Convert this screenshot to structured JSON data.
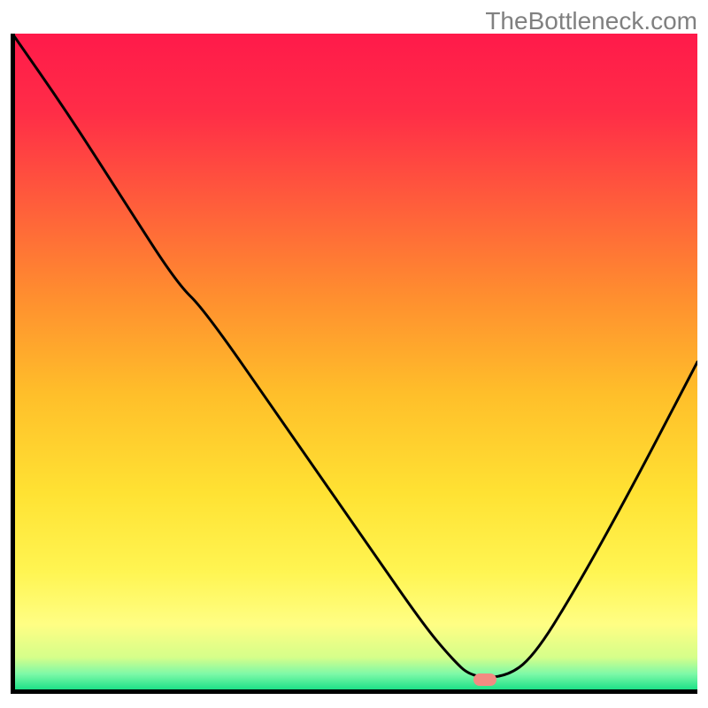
{
  "watermark": "TheBottleneck.com",
  "gradient": {
    "stops": [
      {
        "offset": 0.0,
        "color": "#ff1a4a"
      },
      {
        "offset": 0.12,
        "color": "#ff2d47"
      },
      {
        "offset": 0.25,
        "color": "#ff5a3c"
      },
      {
        "offset": 0.4,
        "color": "#ff8e2f"
      },
      {
        "offset": 0.55,
        "color": "#ffbf2a"
      },
      {
        "offset": 0.7,
        "color": "#ffe233"
      },
      {
        "offset": 0.82,
        "color": "#fff552"
      },
      {
        "offset": 0.9,
        "color": "#fffe84"
      },
      {
        "offset": 0.95,
        "color": "#d5fe8a"
      },
      {
        "offset": 0.975,
        "color": "#7ef9a8"
      },
      {
        "offset": 1.0,
        "color": "#18e086"
      }
    ]
  },
  "marker": {
    "x_pct": 69.0,
    "y_pct": 98.4,
    "color": "#f28b82"
  },
  "axes": {
    "color": "#000000"
  },
  "chart_data": {
    "type": "line",
    "x": [
      0.0,
      0.08,
      0.16,
      0.24,
      0.28,
      0.4,
      0.52,
      0.6,
      0.64,
      0.67,
      0.72,
      0.76,
      0.82,
      0.9,
      1.0
    ],
    "y": [
      1.0,
      0.88,
      0.75,
      0.62,
      0.58,
      0.4,
      0.22,
      0.1,
      0.05,
      0.02,
      0.02,
      0.05,
      0.15,
      0.3,
      0.5
    ],
    "title": "",
    "xlabel": "",
    "ylabel": "",
    "xlim": [
      0,
      1
    ],
    "ylim": [
      0,
      1
    ],
    "series": [
      {
        "name": "curve",
        "color": "#000000"
      }
    ],
    "marker_point": {
      "x": 0.69,
      "y": 0.016
    }
  }
}
